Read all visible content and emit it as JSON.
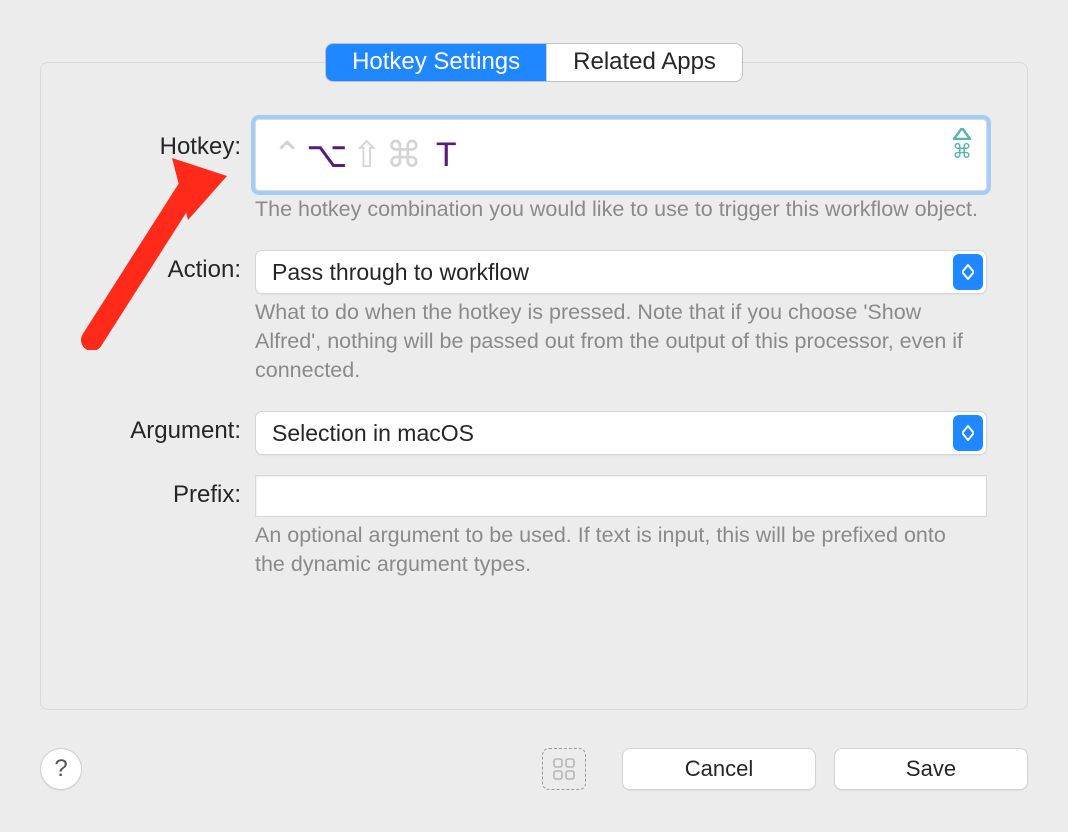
{
  "tabs": {
    "hotkey_settings": "Hotkey Settings",
    "related_apps": "Related Apps",
    "selected": "hotkey_settings"
  },
  "labels": {
    "hotkey": "Hotkey:",
    "action": "Action:",
    "argument": "Argument:",
    "prefix": "Prefix:"
  },
  "hotkey": {
    "ctrl_active": false,
    "option_active": true,
    "shift_active": false,
    "command_active": false,
    "key": "T",
    "help": "The hotkey combination you would like to use to trigger this workflow object."
  },
  "action": {
    "value": "Pass through to workflow",
    "help": "What to do when the hotkey is pressed. Note that if you choose 'Show Alfred', nothing will be passed out from the output of this processor, even if connected."
  },
  "argument": {
    "value": "Selection in macOS"
  },
  "prefix": {
    "value": "",
    "help": "An optional argument to be used. If text is input, this will be prefixed onto the dynamic argument types."
  },
  "footer": {
    "help_glyph": "?",
    "cancel": "Cancel",
    "save": "Save"
  },
  "colors": {
    "accent": "#1f87ff",
    "modifier_active": "#5a1a7a",
    "indicator": "#53b6b0"
  }
}
